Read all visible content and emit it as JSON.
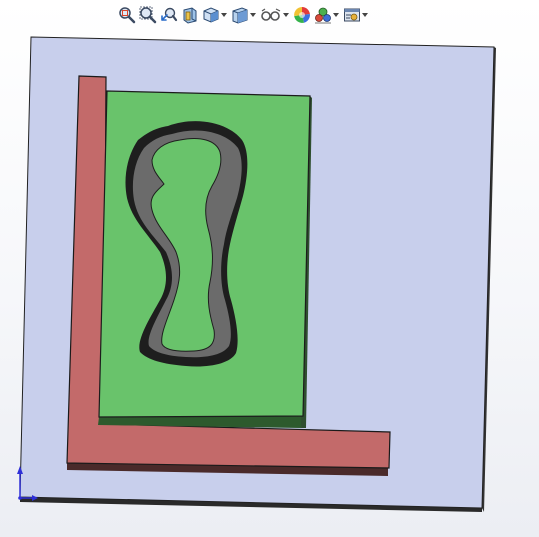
{
  "colors": {
    "background_top": "#ffffff",
    "base_plate": "#c8cfec",
    "plate_edge": "#2a2a2a",
    "l_frame": "#c36a6a",
    "l_frame_side": "#4a2a2a",
    "insert_block": "#69c36b",
    "insert_side": "#2d5a2d",
    "pocket_wall": "#6b6b6b",
    "pocket_rim": "#1e1e1e",
    "triad_axis": "#2f2fd8"
  },
  "toolbar": {
    "items": [
      {
        "name": "zoom-to-fit",
        "icon": "zoom-fit-icon",
        "dropdown": false
      },
      {
        "name": "zoom-to-area",
        "icon": "zoom-area-icon",
        "dropdown": false
      },
      {
        "name": "previous-view",
        "icon": "previous-view-icon",
        "dropdown": false
      },
      {
        "name": "section-view",
        "icon": "section-view-icon",
        "dropdown": false
      },
      {
        "name": "view-orientation",
        "icon": "view-orientation-icon",
        "dropdown": true
      },
      {
        "name": "display-style",
        "icon": "display-style-icon",
        "dropdown": true
      },
      {
        "name": "hide-show-items",
        "icon": "hide-show-icon",
        "dropdown": true
      },
      {
        "name": "edit-appearance",
        "icon": "appearance-icon",
        "dropdown": false
      },
      {
        "name": "apply-scene",
        "icon": "scene-icon",
        "dropdown": true
      },
      {
        "name": "view-settings",
        "icon": "view-settings-icon",
        "dropdown": true
      }
    ]
  },
  "graphics_area": {
    "parts": [
      "base-plate",
      "l-frame",
      "insert-block",
      "pocket-cutout"
    ],
    "triad_axes": [
      "y",
      "x"
    ]
  }
}
